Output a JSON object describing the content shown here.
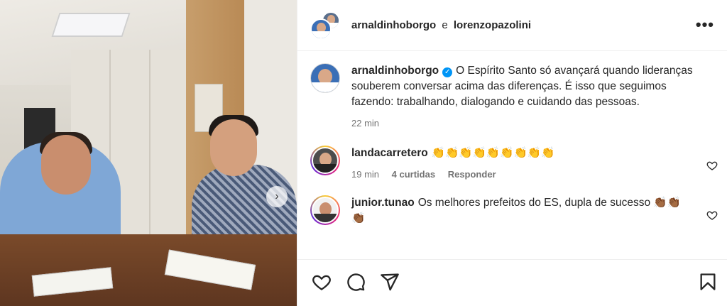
{
  "header": {
    "user1": "arnaldinhoborgo",
    "conjunction": "e",
    "user2": "lorenzopazolini",
    "more_icon": "more-horizontal-icon"
  },
  "caption": {
    "username": "arnaldinhoborgo",
    "verified": true,
    "text": "O Espírito Santo só avançará quando lideranças souberem conversar acima das diferenças. É isso que seguimos fazendo: trabalhando, dialogando e cuidando das pessoas.",
    "time": "22 min"
  },
  "comments": [
    {
      "username": "landacarretero",
      "text": "👏👏👏👏👏👏👏👏👏",
      "time": "19 min",
      "likes": "4 curtidas",
      "reply": "Responder"
    },
    {
      "username": "junior.tunao",
      "text": "Os melhores prefeitos do ES, dupla de sucesso 👏🏾👏🏾👏🏾"
    }
  ],
  "actions": {
    "like": "heart-icon",
    "comment": "comment-icon",
    "share": "send-icon",
    "save": "bookmark-icon"
  },
  "colors": {
    "verified": "#0095f6",
    "muted_text": "#737373",
    "border": "#efefef"
  }
}
